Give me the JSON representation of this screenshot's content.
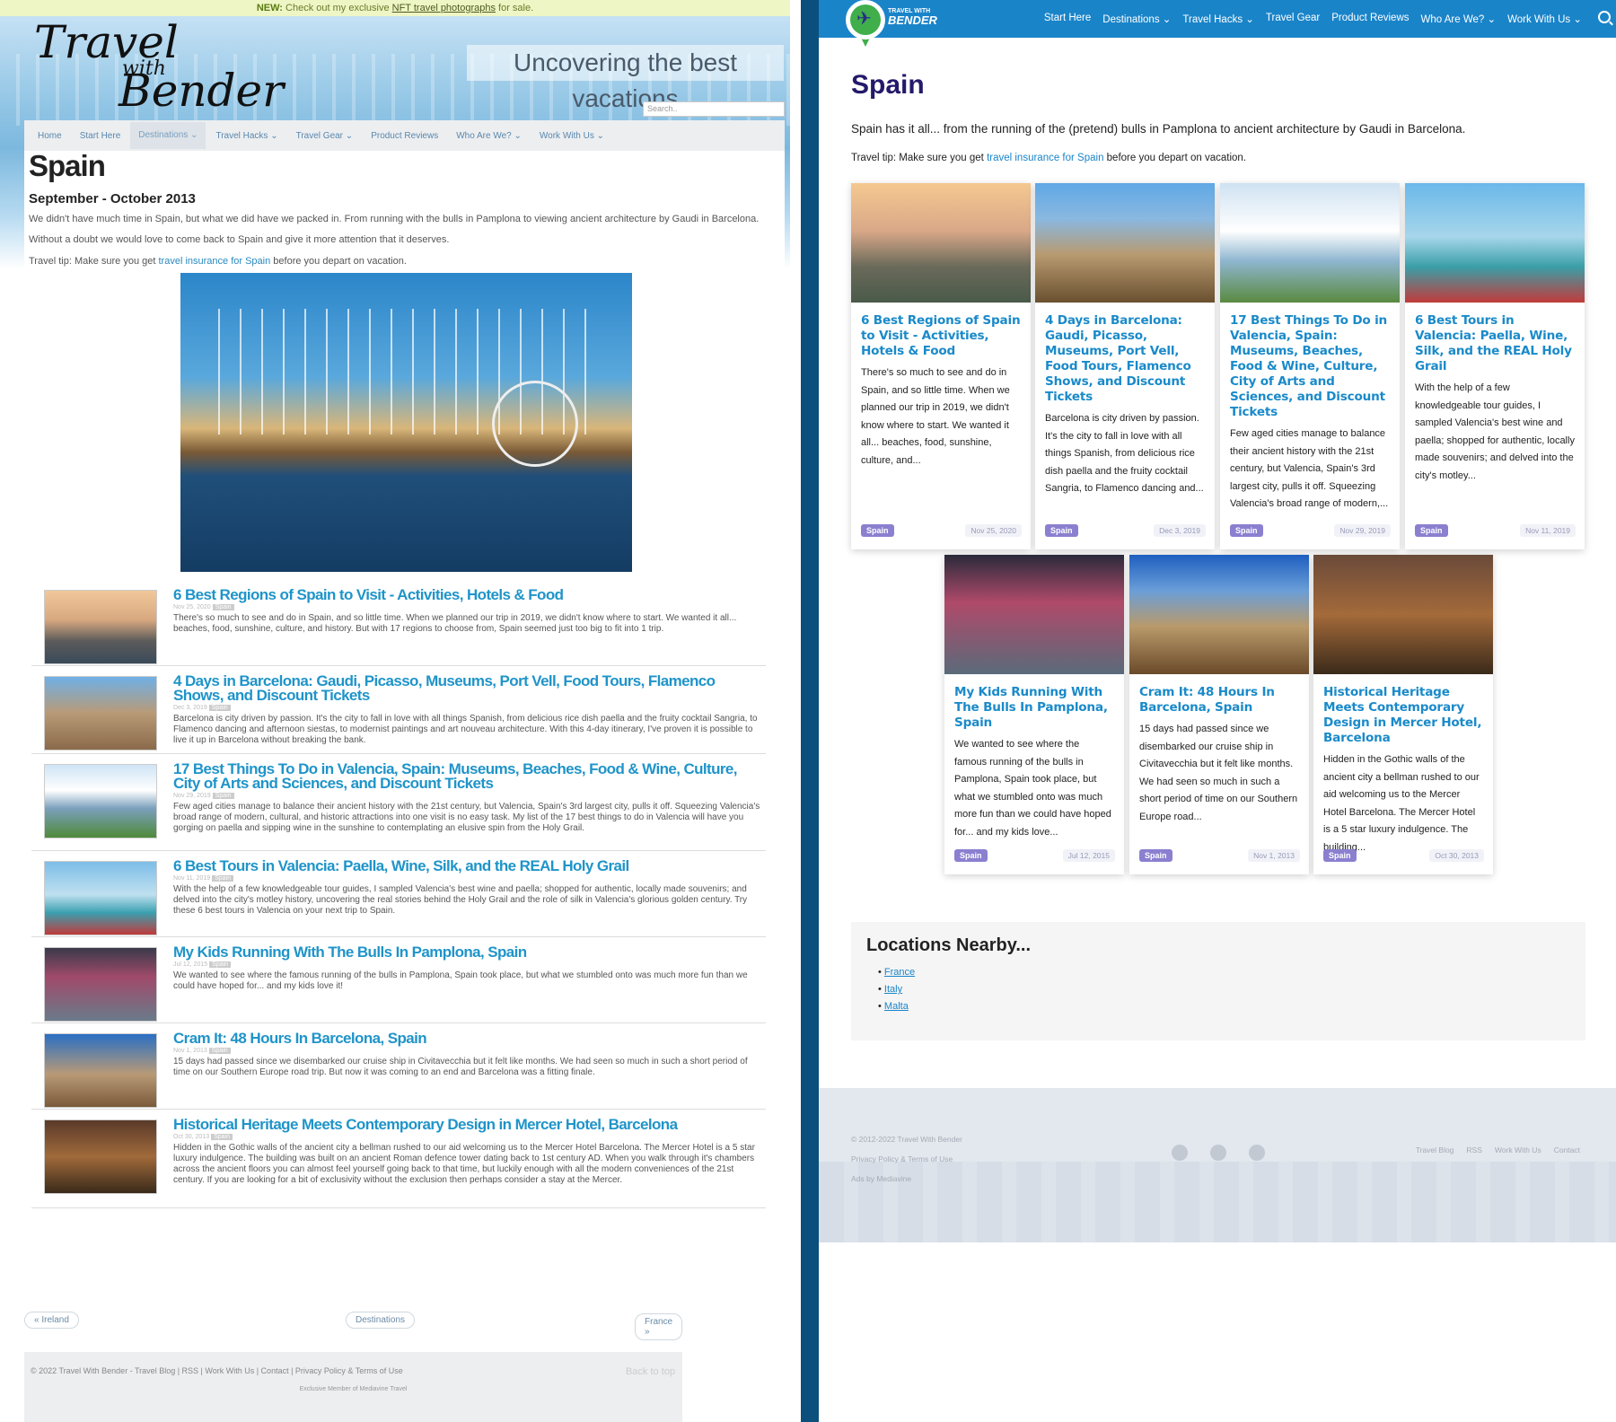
{
  "old_site": {
    "notice": {
      "lead": "NEW:",
      "text1": " Check out my exclusive ",
      "link": "NFT travel photographs",
      "text2": " for sale."
    },
    "logo": {
      "l1": "Travel",
      "l2": "with",
      "l3": "Bender"
    },
    "tagline": "Uncovering the best vacations",
    "search_placeholder": "Search..",
    "nav": [
      "Home",
      "Start Here",
      "Destinations ⌄",
      "Travel Hacks ⌄",
      "Travel Gear ⌄",
      "Product Reviews",
      "Who Are We? ⌄",
      "Work With Us ⌄"
    ],
    "title": "Spain",
    "date_heading": "September - October 2013",
    "intro1": "We didn't have much time in Spain, but what we did have we packed in. From running with the bulls in Pamplona to viewing ancient architecture by Gaudi in Barcelona.",
    "intro2": "Without a doubt we would love to come back to Spain and give it more attention that it deserves.",
    "tip_prefix": "Travel tip: Make sure you get ",
    "tip_link": "travel insurance for Spain",
    "tip_suffix": " before you depart on vacation.",
    "posts": [
      {
        "title": "6 Best Regions of Spain to Visit - Activities, Hotels & Food",
        "date": "Nov 25, 2020",
        "tag": "Spain",
        "excerpt": "There's so much to see and do in Spain, and so little time. When we planned our trip in 2019, we didn't know where to start. We wanted it all... beaches, food, sunshine, culture, and history. But with 17 regions to choose from, Spain seemed just too big to fit into 1 trip."
      },
      {
        "title": "4 Days in Barcelona: Gaudi, Picasso, Museums, Port Vell, Food Tours, Flamenco Shows, and Discount Tickets",
        "date": "Dec 3, 2019",
        "tag": "Spain",
        "excerpt": "Barcelona is city driven by passion. It's the city to fall in love with all things Spanish, from delicious rice dish paella and the fruity cocktail Sangria, to Flamenco dancing and afternoon siestas, to modernist paintings and art nouveau architecture. With this 4-day itinerary, I've proven it is possible to live it up in Barcelona without breaking the bank."
      },
      {
        "title": "17 Best Things To Do in Valencia, Spain: Museums, Beaches, Food & Wine, Culture, City of Arts and Sciences, and Discount Tickets",
        "date": "Nov 29, 2019",
        "tag": "Spain",
        "excerpt": "Few aged cities manage to balance their ancient history with the 21st century, but Valencia, Spain's 3rd largest city, pulls it off. Squeezing Valencia's broad range of modern, cultural, and historic attractions into one visit is no easy task. My list of the 17 best things to do in Valencia will have you gorging on paella and sipping wine in the sunshine to contemplating an elusive spin from the Holy Grail."
      },
      {
        "title": "6 Best Tours in Valencia: Paella, Wine, Silk, and the REAL Holy Grail",
        "date": "Nov 11, 2019",
        "tag": "Spain",
        "excerpt": "With the help of a few knowledgeable tour guides, I sampled Valencia's best wine and paella; shopped for authentic, locally made souvenirs; and delved into the city's motley history, uncovering the real stories behind the Holy Grail and the role of silk in Valencia's glorious golden century. Try these 6 best tours in Valencia on your next trip to Spain."
      },
      {
        "title": "My Kids Running With The Bulls In Pamplona, Spain",
        "date": "Jul 12, 2015",
        "tag": "Spain",
        "excerpt": "We wanted to see where the famous running of the bulls in Pamplona, Spain took place, but what we stumbled onto was much more fun than we could have hoped for... and my kids love it!"
      },
      {
        "title": "Cram It: 48 Hours In Barcelona, Spain",
        "date": "Nov 1, 2013",
        "tag": "Spain",
        "excerpt": "15 days had passed since we disembarked our cruise ship in Civitavecchia but it felt like months. We had seen so much in such a short period of time on our Southern Europe road trip. But now it was coming to an end and Barcelona was a fitting finale."
      },
      {
        "title": "Historical Heritage Meets Contemporary Design in Mercer Hotel, Barcelona",
        "date": "Oct 30, 2013",
        "tag": "Spain",
        "excerpt": "Hidden in the Gothic walls of the ancient city a bellman rushed to our aid welcoming us to the Mercer Hotel Barcelona. The Mercer Hotel is a 5 star luxury indulgence. The building was built on an ancient Roman defence tower dating back to 1st century AD. When you walk through it's chambers across the ancient floors you can almost feel yourself going back to that time, but luckily enough with all the modern conveniences of the 21st century. If you are looking for a bit of exclusivity without the exclusion then perhaps consider a stay at the Mercer."
      }
    ],
    "prev": "« Ireland",
    "middle": "Destinations",
    "next": "France »",
    "footer_copy": "© 2022 Travel With Bender - Travel Blog | RSS | Work With Us | Contact | Privacy Policy & Terms of Use",
    "back_to_top": "Back to top",
    "member": "Exclusive Member of Mediavine Travel"
  },
  "new_site": {
    "logo_line1": "TRAVEL WITH",
    "logo_line2": "BENDER",
    "nav": [
      "Start Here",
      "Destinations ⌄",
      "Travel Hacks ⌄",
      "Travel Gear",
      "Product Reviews",
      "Who Are We? ⌄",
      "Work With Us ⌄"
    ],
    "title": "Spain",
    "intro": "Spain has it all... from the running of the (pretend) bulls in Pamplona to ancient architecture by Gaudi in Barcelona.",
    "tip_prefix": "Travel tip: Make sure you get ",
    "tip_link": "travel insurance for Spain",
    "tip_suffix": " before you depart on vacation.",
    "cards": [
      {
        "title": "6 Best Regions of Spain to Visit - Activities, Hotels & Food",
        "excerpt": "There's so much to see and do in Spain, and so little time. When we planned our trip in 2019, we didn't know where to start. We wanted it all... beaches, food, sunshine, culture, and...",
        "tag": "Spain",
        "date": "Nov 25, 2020"
      },
      {
        "title": "4 Days in Barcelona: Gaudi, Picasso, Museums, Port Vell, Food Tours, Flamenco Shows, and Discount Tickets",
        "excerpt": "Barcelona is city driven by passion. It's the city to fall in love with all things Spanish, from delicious rice dish paella and the fruity cocktail Sangria, to Flamenco dancing and...",
        "tag": "Spain",
        "date": "Dec 3, 2019"
      },
      {
        "title": "17 Best Things To Do in Valencia, Spain: Museums, Beaches, Food & Wine, Culture, City of Arts and Sciences, and Discount Tickets",
        "excerpt": "Few aged cities manage to balance their ancient history with the 21st century, but Valencia, Spain's 3rd largest city, pulls it off. Squeezing Valencia's broad range of modern,...",
        "tag": "Spain",
        "date": "Nov 29, 2019"
      },
      {
        "title": "6 Best Tours in Valencia: Paella, Wine, Silk, and the REAL Holy Grail",
        "excerpt": "With the help of a few knowledgeable tour guides, I sampled Valencia's best wine and paella; shopped for authentic, locally made souvenirs; and delved into the city's motley...",
        "tag": "Spain",
        "date": "Nov 11, 2019"
      },
      {
        "title": "My Kids Running With The Bulls In Pamplona, Spain",
        "excerpt": "We wanted to see where the famous running of the bulls in Pamplona, Spain took place, but what we stumbled onto was much more fun than we could have hoped for... and my kids love...",
        "tag": "Spain",
        "date": "Jul 12, 2015"
      },
      {
        "title": "Cram It: 48 Hours In Barcelona, Spain",
        "excerpt": "15 days had passed since we disembarked our cruise ship in Civitavecchia but it felt like months. We had seen so much in such a short period of time on our Southern Europe road...",
        "tag": "Spain",
        "date": "Nov 1, 2013"
      },
      {
        "title": "Historical Heritage Meets Contemporary Design in Mercer Hotel, Barcelona",
        "excerpt": "Hidden in the Gothic walls of the ancient city a bellman rushed to our aid welcoming us to the Mercer Hotel Barcelona. The Mercer Hotel is a 5 star luxury indulgence. The building...",
        "tag": "Spain",
        "date": "Oct 30, 2013"
      }
    ],
    "nearby_title": "Locations Nearby...",
    "nearby": [
      "France",
      "Italy",
      "Malta"
    ],
    "footer": {
      "copy": "© 2012-2022 Travel With Bender",
      "privacy": "Privacy Policy & Terms of Use",
      "ads": "Ads by Mediavine",
      "links": [
        "Travel Blog",
        "RSS",
        "Work With Us",
        "Contact"
      ],
      "social": [
        "twitter-icon",
        "facebook-icon",
        "pinterest-icon"
      ]
    }
  }
}
